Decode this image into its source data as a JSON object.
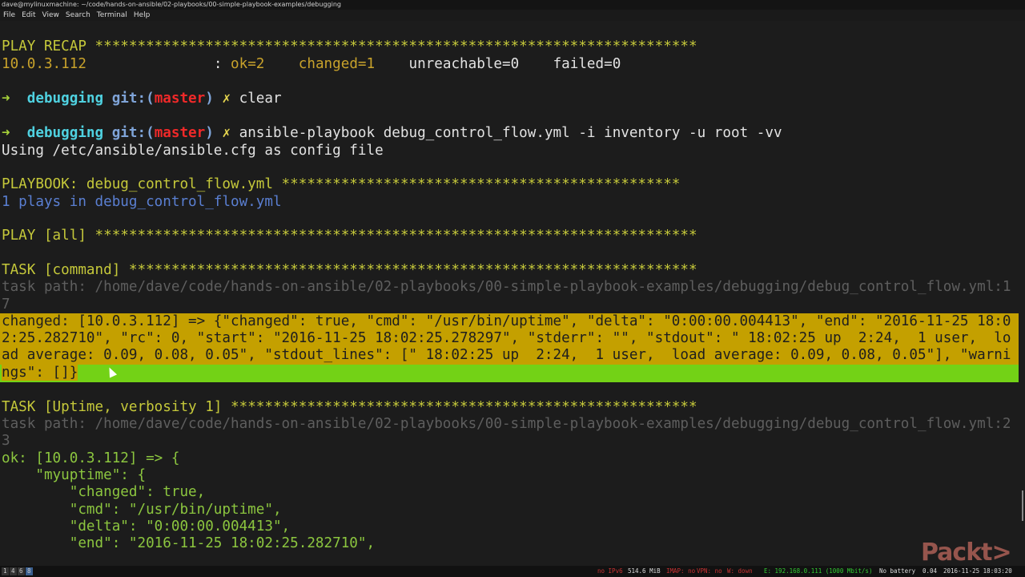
{
  "window": {
    "title": "dave@mylinuxmachine: ~/code/hands-on-ansible/02-playbooks/00-simple-playbook-examples/debugging"
  },
  "menu": [
    "File",
    "Edit",
    "View",
    "Search",
    "Terminal",
    "Help"
  ],
  "terminal": {
    "recap_header": "PLAY RECAP ***********************************************************************",
    "recap_host": "10.0.3.112",
    "recap_colon": "               : ",
    "recap_ok": "ok=2",
    "recap_changed": "changed=1",
    "recap_unreachable": "unreachable=0",
    "recap_failed": "failed=0",
    "prompt_arrow": "➜",
    "prompt_dir": "debugging",
    "prompt_git": "git:(",
    "prompt_branch": "master",
    "prompt_git_close": ")",
    "prompt_dirty": "✗",
    "cmd1": "clear",
    "cmd2": "ansible-playbook debug_control_flow.yml -i inventory -u root -vv",
    "config_line": "Using /etc/ansible/ansible.cfg as config file",
    "playbook_line": "PLAYBOOK: debug_control_flow.yml ***********************************************",
    "plays_line": "1 plays in debug_control_flow.yml",
    "play_line": "PLAY [all] ***********************************************************************",
    "task1_line": "TASK [command] *******************************************************************",
    "task1_path_a": "task path: /home/dave/code/hands-on-ansible/02-playbooks/00-simple-playbook-examples/debugging/debug_control_flow.yml:1",
    "task1_path_b": "7",
    "changed_1": "changed: [10.0.3.112] => {\"changed\": true, \"cmd\": \"/usr/bin/uptime\", \"delta\": \"0:00:00.004413\", \"end\": \"2016-11-25 18:0",
    "changed_2": "2:25.282710\", \"rc\": 0, \"start\": \"2016-11-25 18:02:25.278297\", \"stderr\": \"\", \"stdout\": \" 18:02:25 up  2:24,  1 user,  lo",
    "changed_3": "ad average: 0.09, 0.08, 0.05\", \"stdout_lines\": [\" 18:02:25 up  2:24,  1 user,  load average: 0.09, 0.08, 0.05\"], \"warni",
    "changed_4": "ngs\": []}",
    "task2_line": "TASK [Uptime, verbosity 1] *******************************************************",
    "task2_path_a": "task path: /home/dave/code/hands-on-ansible/02-playbooks/00-simple-playbook-examples/debugging/debug_control_flow.yml:2",
    "task2_path_b": "3",
    "ok_line": "ok: [10.0.3.112] => {",
    "my_line": "    \"myuptime\": {",
    "k_changed": "        \"changed\": true,",
    "k_cmd": "        \"cmd\": \"/usr/bin/uptime\",",
    "k_delta": "        \"delta\": \"0:00:00.004413\",",
    "k_end": "        \"end\": \"2016-11-25 18:02:25.282710\","
  },
  "logo": "Packt>",
  "taskbar": {
    "workspaces": [
      "1",
      "4",
      "6",
      "8"
    ],
    "status": [
      "no IPv6",
      "514.6 MiB",
      "IMAP: no",
      "VPN: no",
      "W: down",
      "E: 192.168.0.111 (1000 Mbit/s)",
      "No battery",
      "0.04",
      "2016-11-25 18:03:20"
    ]
  },
  "colors": {
    "background": "#1c1c1c",
    "highlight_changed": "#c4a000",
    "highlight_green": "#73d216",
    "prompt_cyan": "#4fd1e0",
    "branch_red": "#ef2929"
  }
}
